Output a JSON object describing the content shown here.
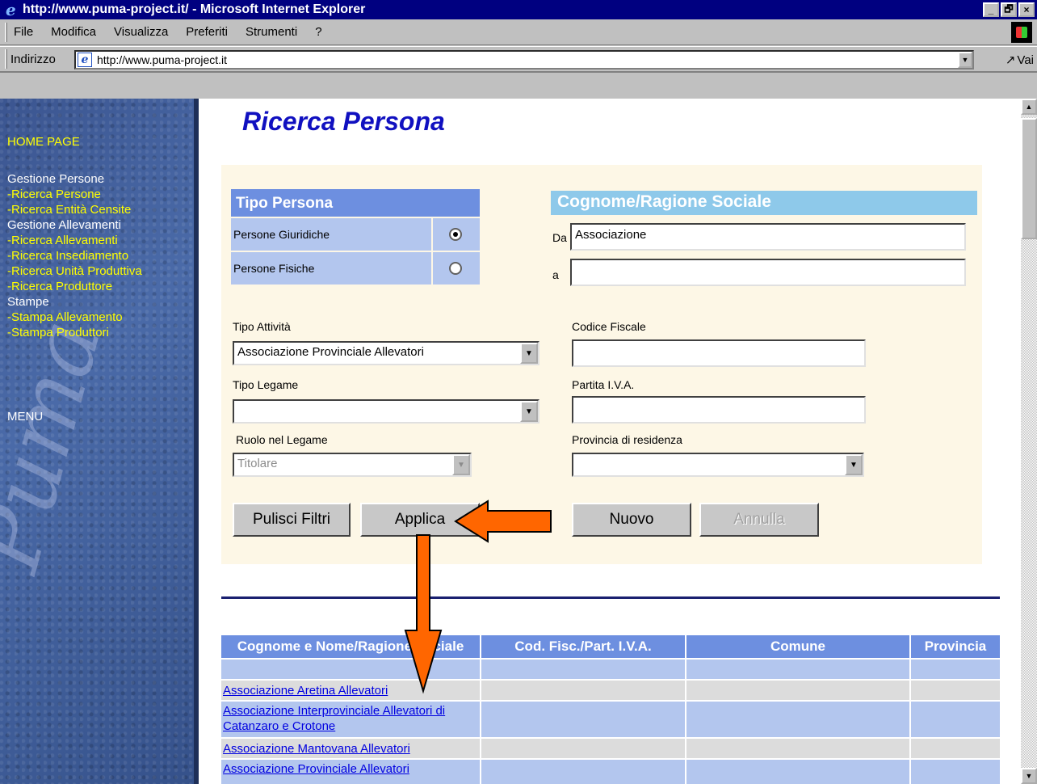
{
  "window": {
    "title": "http://www.puma-project.it/ - Microsoft Internet Explorer",
    "controls": [
      "_",
      "🗗",
      "×"
    ]
  },
  "menu": [
    "File",
    "Modifica",
    "Visualizza",
    "Preferiti",
    "Strumenti",
    "?"
  ],
  "address": {
    "label": "Indirizzo",
    "url": "http://www.puma-project.it",
    "go_label": "Vai"
  },
  "sidebar": {
    "home": "HOME PAGE",
    "section1": "Gestione Persone",
    "link1": "-Ricerca Persone",
    "link2": "-Ricerca Entità Censite",
    "section2": "Gestione Allevamenti",
    "link3": "-Ricerca Allevamenti",
    "link4": "-Ricerca Insediamento",
    "link5": "-Ricerca Unità Produttiva",
    "link6": "-Ricerca Produttore",
    "section3": "Stampe",
    "link7": "-Stampa Allevamento",
    "link8": "-Stampa Produttori",
    "menu": "MENU"
  },
  "page": {
    "title": "Ricerca Persona"
  },
  "form": {
    "tipo_persona_header": "Tipo Persona",
    "persone_giuridiche": "Persone Giuridiche",
    "persone_fisiche": "Persone Fisiche",
    "giuridiche_selected": true,
    "cognome_header": "Cognome/Ragione Sociale",
    "da_label": "Da",
    "da_value": "Associazione",
    "a_label": "a",
    "a_value": "",
    "tipo_attivita_label": "Tipo Attività",
    "tipo_attivita_value": "Associazione Provinciale Allevatori",
    "codice_fiscale_label": "Codice Fiscale",
    "codice_fiscale_value": "",
    "tipo_legame_label": "Tipo Legame",
    "tipo_legame_value": "",
    "partita_iva_label": "Partita I.V.A.",
    "partita_iva_value": "",
    "ruolo_label": "Ruolo nel Legame",
    "ruolo_value": "Titolare",
    "provincia_label": "Provincia di residenza",
    "provincia_value": ""
  },
  "buttons": {
    "pulisci": "Pulisci Filtri",
    "applica": "Applica",
    "nuovo": "Nuovo",
    "annulla": "Annulla"
  },
  "results": {
    "columns": [
      "Cognome e Nome/Ragione Sociale",
      "Cod. Fisc./Part. I.V.A.",
      "Comune",
      "Provincia"
    ],
    "rows": [
      [
        "",
        "",
        "",
        ""
      ],
      [
        "Associazione Aretina Allevatori",
        "",
        "",
        ""
      ],
      [
        "Associazione Interprovinciale Allevatori di Catanzaro e Crotone",
        "",
        "",
        ""
      ],
      [
        "Associazione Mantovana Allevatori",
        "",
        "",
        ""
      ],
      [
        "Associazione Provinciale Allevatori",
        "",
        "",
        ""
      ]
    ]
  },
  "colors": {
    "header_blue": "#6d8fe0",
    "cell_blue": "#b3c6ee",
    "arrow_orange": "#ff6600",
    "title_blue": "#1010c0"
  }
}
